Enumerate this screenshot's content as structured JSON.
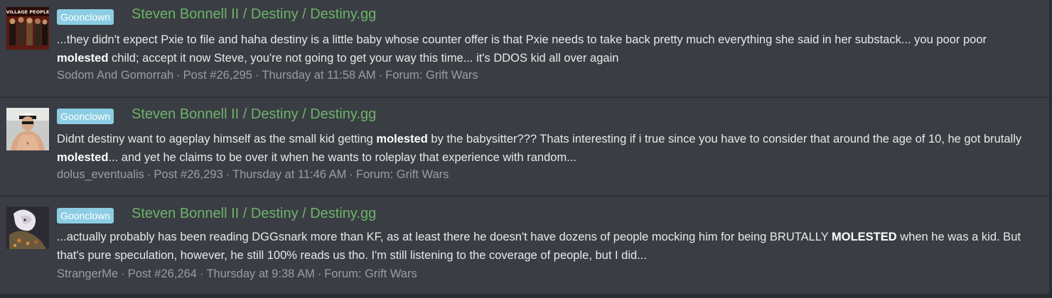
{
  "results": [
    {
      "avatar_label": "VILLAGE PEOPLE",
      "prefix": "Goonclown",
      "thread_title": "Steven Bonnell II / Destiny / Destiny.gg",
      "snippet": [
        {
          "text": "...they didn't expect Pxie to file and haha destiny is a little baby whose counter offer is that Pxie needs to take back pretty much everything she said in her substack... you poor poor ",
          "bold": false
        },
        {
          "text": "molested",
          "bold": true
        },
        {
          "text": " child; accept it now Steve, you're not going to get your way this time... it's DDOS kid all over again",
          "bold": false
        }
      ],
      "author": "Sodom And Gomorrah",
      "post": "Post #26,295",
      "time": "Thursday at 11:58 AM",
      "forum_label": "Forum:",
      "forum": "Grift Wars"
    },
    {
      "avatar_label": "",
      "prefix": "Goonclown",
      "thread_title": "Steven Bonnell II / Destiny / Destiny.gg",
      "snippet": [
        {
          "text": "Didnt destiny want to ageplay himself as the small kid getting ",
          "bold": false
        },
        {
          "text": "molested",
          "bold": true
        },
        {
          "text": " by the babysitter??? Thats interesting if i true since you have to consider that around the age of 10, he got brutally ",
          "bold": false
        },
        {
          "text": "molested",
          "bold": true
        },
        {
          "text": "... and yet he claims to be over it when he wants to roleplay that experience with random...",
          "bold": false
        }
      ],
      "author": "dolus_eventualis",
      "post": "Post #26,293",
      "time": "Thursday at 11:46 AM",
      "forum_label": "Forum:",
      "forum": "Grift Wars"
    },
    {
      "avatar_label": "",
      "prefix": "Goonclown",
      "thread_title": "Steven Bonnell II / Destiny / Destiny.gg",
      "snippet": [
        {
          "text": "...actually probably has been reading DGGsnark more than KF, as at least there he doesn't have dozens of people mocking him for being BRUTALLY ",
          "bold": false
        },
        {
          "text": "MOLESTED",
          "bold": true
        },
        {
          "text": " when he was a kid. But that's pure speculation, however, he still 100% reads us tho. I'm still listening to the coverage of people, but I did...",
          "bold": false
        }
      ],
      "author": "StrangerMe",
      "post": "Post #26,264",
      "time": "Thursday at 9:38 AM",
      "forum_label": "Forum:",
      "forum": "Grift Wars"
    }
  ],
  "separator": "·",
  "colors": {
    "background": "#3a3d43",
    "prefix_bg": "#8ccde3",
    "title": "#6db36a",
    "meta": "#9a9ea4",
    "text": "#e8e8e8"
  }
}
